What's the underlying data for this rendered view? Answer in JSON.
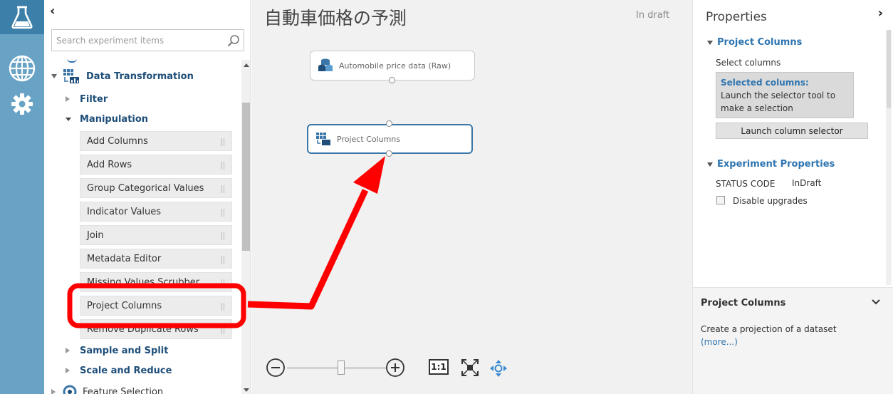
{
  "rail": {
    "items": [
      {
        "icon": "flask-icon",
        "active": true
      },
      {
        "icon": "globe-icon",
        "active": false
      },
      {
        "icon": "gear-icon",
        "active": false
      }
    ]
  },
  "palette": {
    "collapse_glyph": "‹",
    "search_placeholder": "Search experiment items",
    "category": "Data Transformation",
    "groups": {
      "filter": "Filter",
      "manipulation": "Manipulation",
      "sample_split": "Sample and Split",
      "scale_reduce": "Scale and Reduce"
    },
    "modules": [
      "Add Columns",
      "Add Rows",
      "Group Categorical Values",
      "Indicator Values",
      "Join",
      "Metadata Editor",
      "Missing Values Scrubber",
      "Project Columns",
      "Remove Duplicate Rows"
    ],
    "next_category": "Feature Selection"
  },
  "canvas": {
    "title": "自動車価格の予測",
    "status": "In draft",
    "nodes": {
      "dataset": "Automobile price data (Raw)",
      "project": "Project Columns"
    },
    "zoom": {
      "fit_label": "1:1",
      "level_fraction": 0.5
    }
  },
  "properties": {
    "title": "Properties",
    "chevron": "›",
    "section1": "Project Columns",
    "select_columns": "Select columns",
    "selected_header": "Selected columns:",
    "selected_text": "Launch the selector tool to make a selection",
    "launch_button": "Launch column selector",
    "section2": "Experiment Properties",
    "status_label": "STATUS CODE",
    "status_value": "InDraft",
    "disable_upgrades": "Disable upgrades"
  },
  "help": {
    "title": "Project Columns",
    "description": "Create a projection of a dataset",
    "more": "(more...)"
  },
  "colors": {
    "rail": "#68a3c6",
    "rail_active": "#3c7fa8",
    "accent": "#2f75b0",
    "annotation": "#ff0000"
  }
}
